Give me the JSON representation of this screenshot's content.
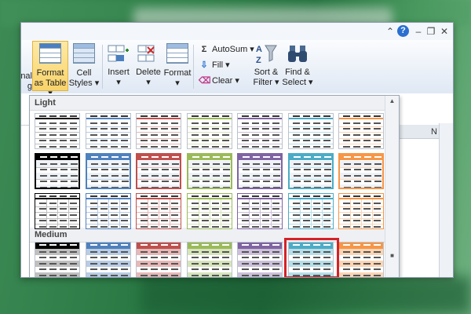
{
  "window": {
    "controls": [
      {
        "name": "ribbon-minimize",
        "glyph": "⌃"
      },
      {
        "name": "help",
        "glyph": "?"
      },
      {
        "name": "minimize",
        "glyph": "–"
      },
      {
        "name": "restore",
        "glyph": "❐"
      },
      {
        "name": "close",
        "glyph": "✕"
      }
    ]
  },
  "ribbon": {
    "partial_left": {
      "line1": "nal",
      "line2": "g"
    },
    "format_as_table": {
      "line1": "Format",
      "line2": "as Table"
    },
    "cell_styles": {
      "line1": "Cell",
      "line2": "Styles"
    },
    "insert": {
      "label": "Insert"
    },
    "delete": {
      "label": "Delete"
    },
    "format": {
      "label": "Format"
    },
    "autosum": {
      "label": "AutoSum"
    },
    "fill": {
      "label": "Fill"
    },
    "clear": {
      "label": "Clear"
    },
    "sort_filter": {
      "line1": "Sort &",
      "line2": "Filter"
    },
    "find_select": {
      "line1": "Find &",
      "line2": "Select"
    }
  },
  "sheet": {
    "column_letter": "N"
  },
  "gallery": {
    "sections": [
      {
        "label": "Light"
      },
      {
        "label": "Medium"
      }
    ],
    "colors": [
      "#000000",
      "#4f81bd",
      "#c0504d",
      "#9bbb59",
      "#8064a2",
      "#4bacc6",
      "#f79646"
    ],
    "light_colors": [
      "#bfbfbf",
      "#b8cce4",
      "#e6b8b7",
      "#d7e4bc",
      "#ccc0da",
      "#b7dee8",
      "#fcd5b4"
    ],
    "selected": {
      "section": "Medium",
      "row": 0,
      "col": 5
    }
  }
}
